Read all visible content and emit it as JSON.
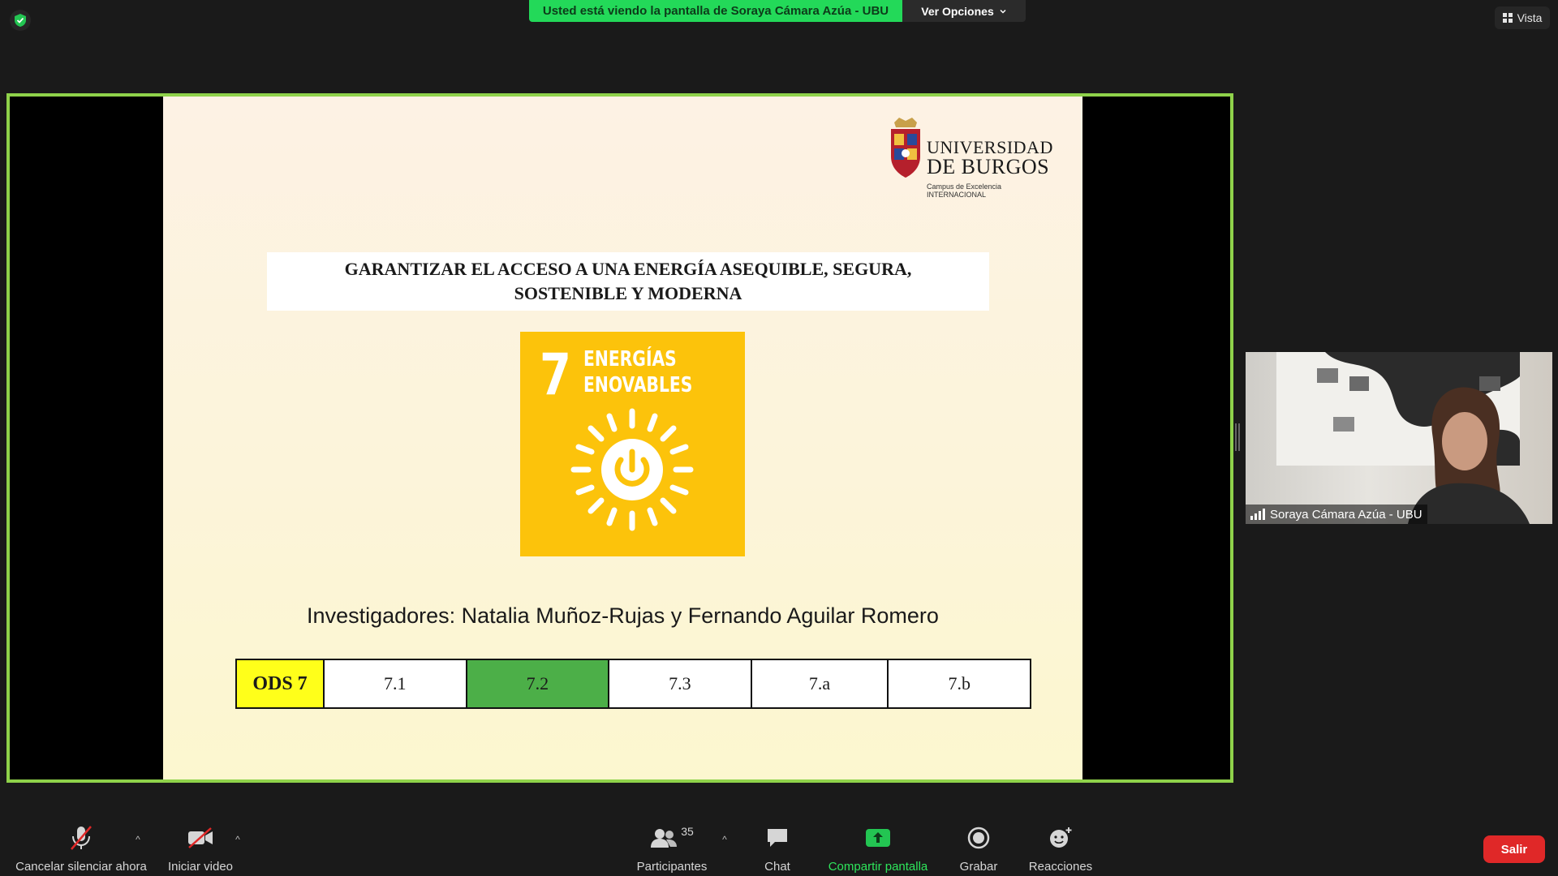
{
  "top_bar": {
    "share_banner": "Usted está viendo la pantalla de Soraya Cámara Azúa - UBU",
    "view_options": "Ver Opciones",
    "vista": "Vista"
  },
  "slide": {
    "logo_line1": "UNIVERSIDAD",
    "logo_line2": "DE BURGOS",
    "logo_sub": "Campus de Excelencia INTERNACIONAL",
    "title_line1": "GARANTIZAR EL ACCESO A UNA ENERGÍA ASEQUIBLE, SEGURA,",
    "title_line2": "SOSTENIBLE Y MODERNA",
    "sdg_number": "7",
    "sdg_name_line1": "ENERGÍAS",
    "sdg_name_line2": "ENOVABLES",
    "researchers": "Investigadores: Natalia  Muñoz-Rujas y Fernando Aguilar Romero",
    "ods_label": "ODS 7",
    "targets": [
      "7.1",
      "7.2",
      "7.3",
      "7.a",
      "7.b"
    ],
    "active_target": "7.2"
  },
  "participant": {
    "name": "Soraya Cámara Azúa - UBU"
  },
  "toolbar": {
    "mute": "Cancelar silenciar ahora",
    "video": "Iniciar video",
    "participants": "Participantes",
    "participants_count": "35",
    "chat": "Chat",
    "share": "Compartir pantalla",
    "record": "Grabar",
    "reactions": "Reacciones",
    "exit": "Salir"
  },
  "colors": {
    "share_green": "#23d959",
    "frame_green": "#8fd24a",
    "sdg_yellow": "#fcc30b",
    "active_cell": "#4caf48",
    "ods_label_bg": "#ffff1a",
    "exit_red": "#e02828"
  }
}
